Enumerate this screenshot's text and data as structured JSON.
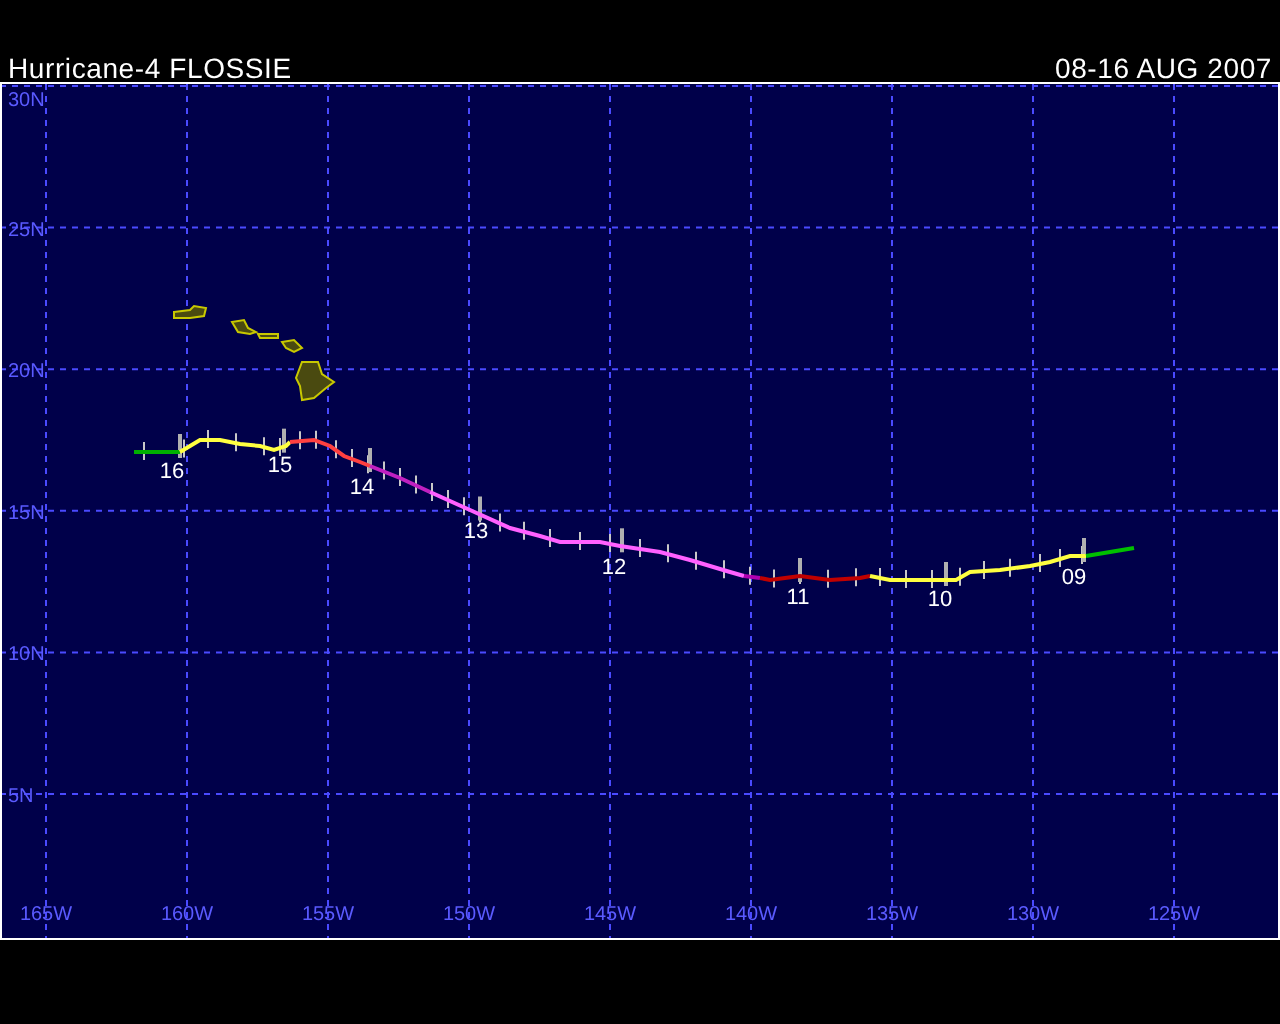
{
  "header": {
    "title": "Hurricane-4 FLOSSIE",
    "dates": "08-16 AUG 2007"
  },
  "map": {
    "latitude_labels": [
      "30N",
      "25N",
      "20N",
      "15N",
      "10N",
      "5N"
    ],
    "longitude_labels": [
      "165W",
      "160W",
      "155W",
      "150W",
      "145W",
      "140W",
      "135W",
      "130W",
      "125W"
    ],
    "day_labels": [
      "16",
      "15",
      "14",
      "13",
      "12",
      "11",
      "10",
      "09"
    ]
  }
}
